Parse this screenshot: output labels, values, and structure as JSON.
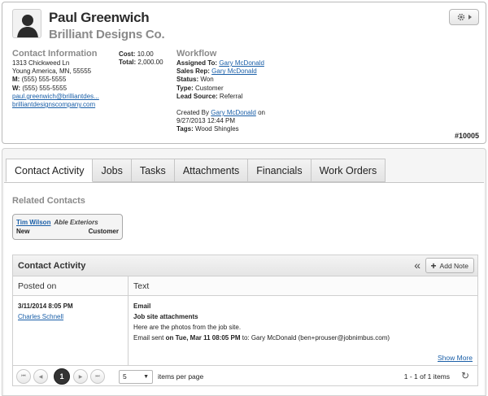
{
  "contact": {
    "name": "Paul Greenwich",
    "company": "Brilliant Designs Co.",
    "info_title": "Contact Information",
    "address1": "1313 Chickweed Ln",
    "address2": "Young America, MN, 55555",
    "mobile_label": "M:",
    "mobile": "(555) 555-5555",
    "work_label": "W:",
    "work": "(555) 555-5555",
    "email": "paul.greenwich@brilliantdes...",
    "website": "brilliantdesignscompany.com",
    "cost_label": "Cost:",
    "cost": "10.00",
    "total_label": "Total:",
    "total": "2,000.00"
  },
  "workflow": {
    "title": "Workflow",
    "assigned_label": "Assigned To:",
    "assigned": "Gary McDonald",
    "salesrep_label": "Sales Rep:",
    "salesrep": "Gary McDonald",
    "status_label": "Status:",
    "status": "Won",
    "type_label": "Type:",
    "type": "Customer",
    "lead_label": "Lead Source:",
    "lead": "Referral",
    "created_prefix": "Created By",
    "created_by": "Gary McDonald",
    "created_suffix": "on",
    "created_date": "9/27/2013 12:44 PM",
    "tags_label": "Tags:",
    "tags": "Wood Shingles"
  },
  "job_number": "#10005",
  "tabs": [
    "Contact Activity",
    "Jobs",
    "Tasks",
    "Attachments",
    "Financials",
    "Work Orders"
  ],
  "related": {
    "title": "Related Contacts",
    "name": "Tim Wilson",
    "company": "Able Exteriors",
    "status": "New",
    "type": "Customer"
  },
  "activity": {
    "title": "Contact Activity",
    "collapse_glyph": "«",
    "add_note": "Add Note",
    "col_posted": "Posted on",
    "col_text": "Text",
    "row": {
      "date": "3/11/2014 8:05 PM",
      "author": "Charles Schnell",
      "kind": "Email",
      "subject": "Job site attachments",
      "body": "Here are the photos from the job site.",
      "sent_prefix": "Email sent",
      "sent_when": "on Tue, Mar 11 08:05 PM",
      "sent_suffix": "to: Gary McDonald (ben+prouser@jobnimbus.com)",
      "show_more": "Show More"
    },
    "pager": {
      "first": "⏮",
      "prev": "◀",
      "page": "1",
      "next": "▶",
      "last": "⏭",
      "per_page": "5",
      "per_page_label": "items per page",
      "range": "1 - 1 of 1 items",
      "refresh": "↻"
    }
  }
}
